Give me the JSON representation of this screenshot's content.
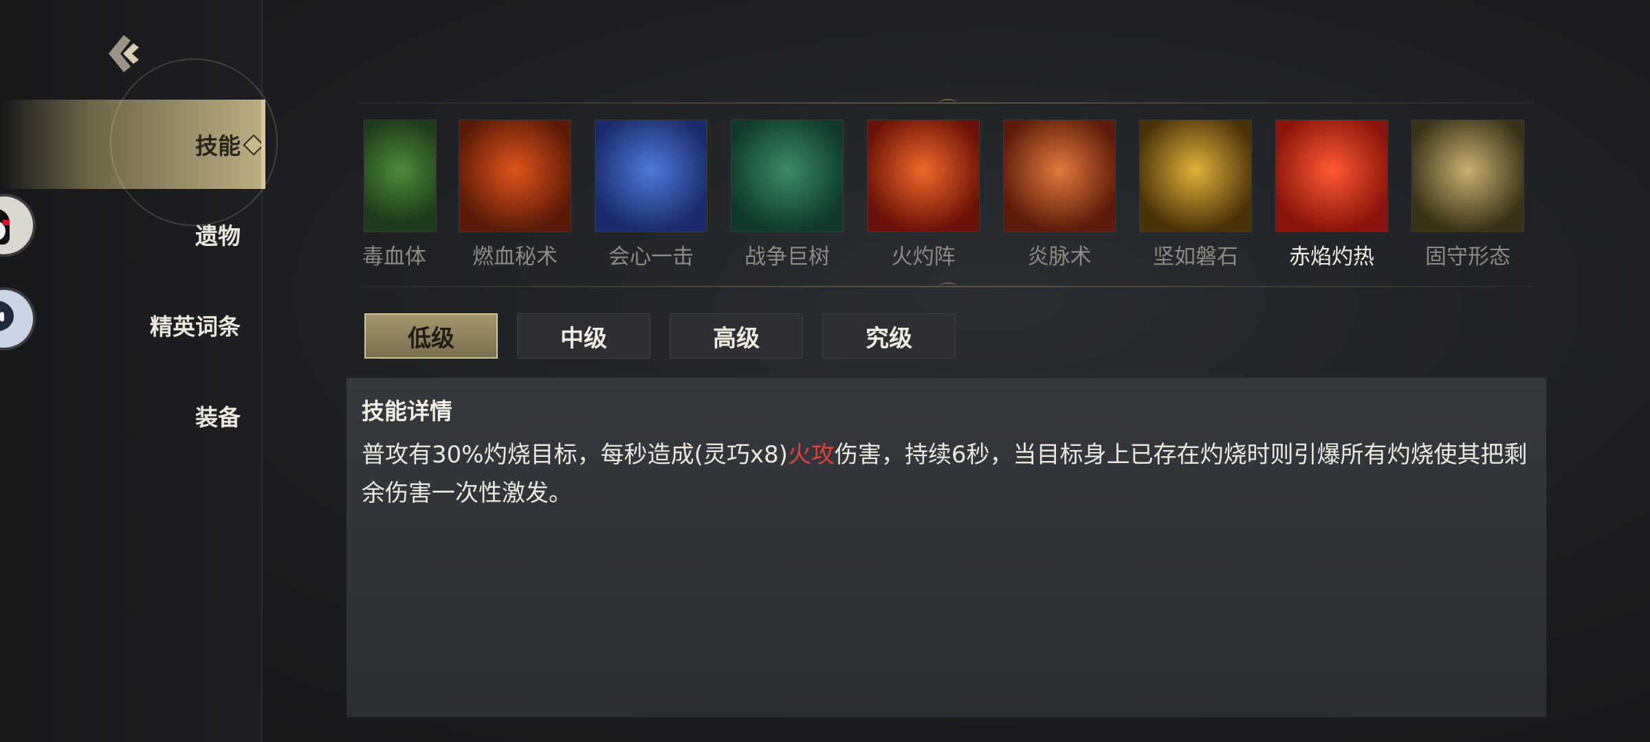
{
  "nav": {
    "items": [
      {
        "label": "技能",
        "active": true
      },
      {
        "label": "遗物",
        "active": false
      },
      {
        "label": "精英词条",
        "active": false
      },
      {
        "label": "装备",
        "active": false
      }
    ]
  },
  "skills": [
    {
      "name": "毒血体",
      "colors": [
        "#1d3a1a",
        "#4f8a3a"
      ],
      "selected": false
    },
    {
      "name": "燃血秘术",
      "colors": [
        "#5a1a08",
        "#e0541a"
      ],
      "selected": false
    },
    {
      "name": "会心一击",
      "colors": [
        "#1a2a6a",
        "#4e7ad8"
      ],
      "selected": false
    },
    {
      "name": "战争巨树",
      "colors": [
        "#0f3a2a",
        "#3c8a66"
      ],
      "selected": false
    },
    {
      "name": "火灼阵",
      "colors": [
        "#6a1208",
        "#f0682a"
      ],
      "selected": false
    },
    {
      "name": "炎脉术",
      "colors": [
        "#5c1a0a",
        "#e07a3a"
      ],
      "selected": false
    },
    {
      "name": "坚如磐石",
      "colors": [
        "#4a3208",
        "#e0b23a"
      ],
      "selected": false
    },
    {
      "name": "赤焰灼热",
      "colors": [
        "#8a140c",
        "#ff5a30"
      ],
      "selected": true
    },
    {
      "name": "固守形态",
      "colors": [
        "#3a3218",
        "#c8b070"
      ],
      "selected": false
    }
  ],
  "tiers": [
    {
      "label": "低级",
      "active": true
    },
    {
      "label": "中级",
      "active": false
    },
    {
      "label": "高级",
      "active": false
    },
    {
      "label": "究级",
      "active": false
    }
  ],
  "detail": {
    "title": "技能详情",
    "text_before": "普攻有30%灼烧目标，每秒造成(灵巧x8)",
    "highlight": "火攻",
    "text_after": "伤害，持续6秒，当目标身上已存在灼烧时则引爆所有灼烧使其把剩余伤害一次性激发。"
  },
  "colors": {
    "accent_gold": "#bcae83",
    "fire_text": "#d9433c"
  }
}
